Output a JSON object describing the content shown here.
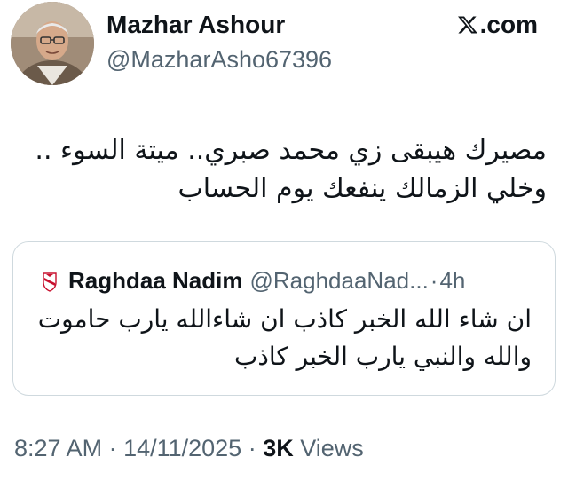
{
  "author": {
    "name": "Mazhar Ashour",
    "handle": "@MazharAsho67396",
    "avatar_icon": "person-photo-avatar"
  },
  "brand": {
    "site": ".com",
    "icon": "x-logo-icon"
  },
  "tweet": {
    "lines": [
      "مصيرك هيبقى زي محمد صبري.. ميتة السوء ..",
      "وخلي الزمالك ينفعك يوم الحساب"
    ]
  },
  "quote": {
    "avatar_icon": "zamalek-club-badge-icon",
    "name": "Raghdaa Nadim",
    "handle": "@RaghdaaNad...",
    "separator": "·",
    "time": "4h",
    "lines": [
      "ان شاء الله الخبر كاذب ان شاءالله يارب حاموت",
      "والله والنبي يارب الخبر كاذب"
    ]
  },
  "meta": {
    "time": "8:27 AM",
    "sep1": " · ",
    "date": "14/11/2025",
    "sep2": " · ",
    "views_count": "3K",
    "views_label": " Views"
  },
  "colors": {
    "text_primary": "#0f1419",
    "text_secondary": "#536471",
    "border": "#cfd9de",
    "zamalek_red": "#c8102e"
  }
}
